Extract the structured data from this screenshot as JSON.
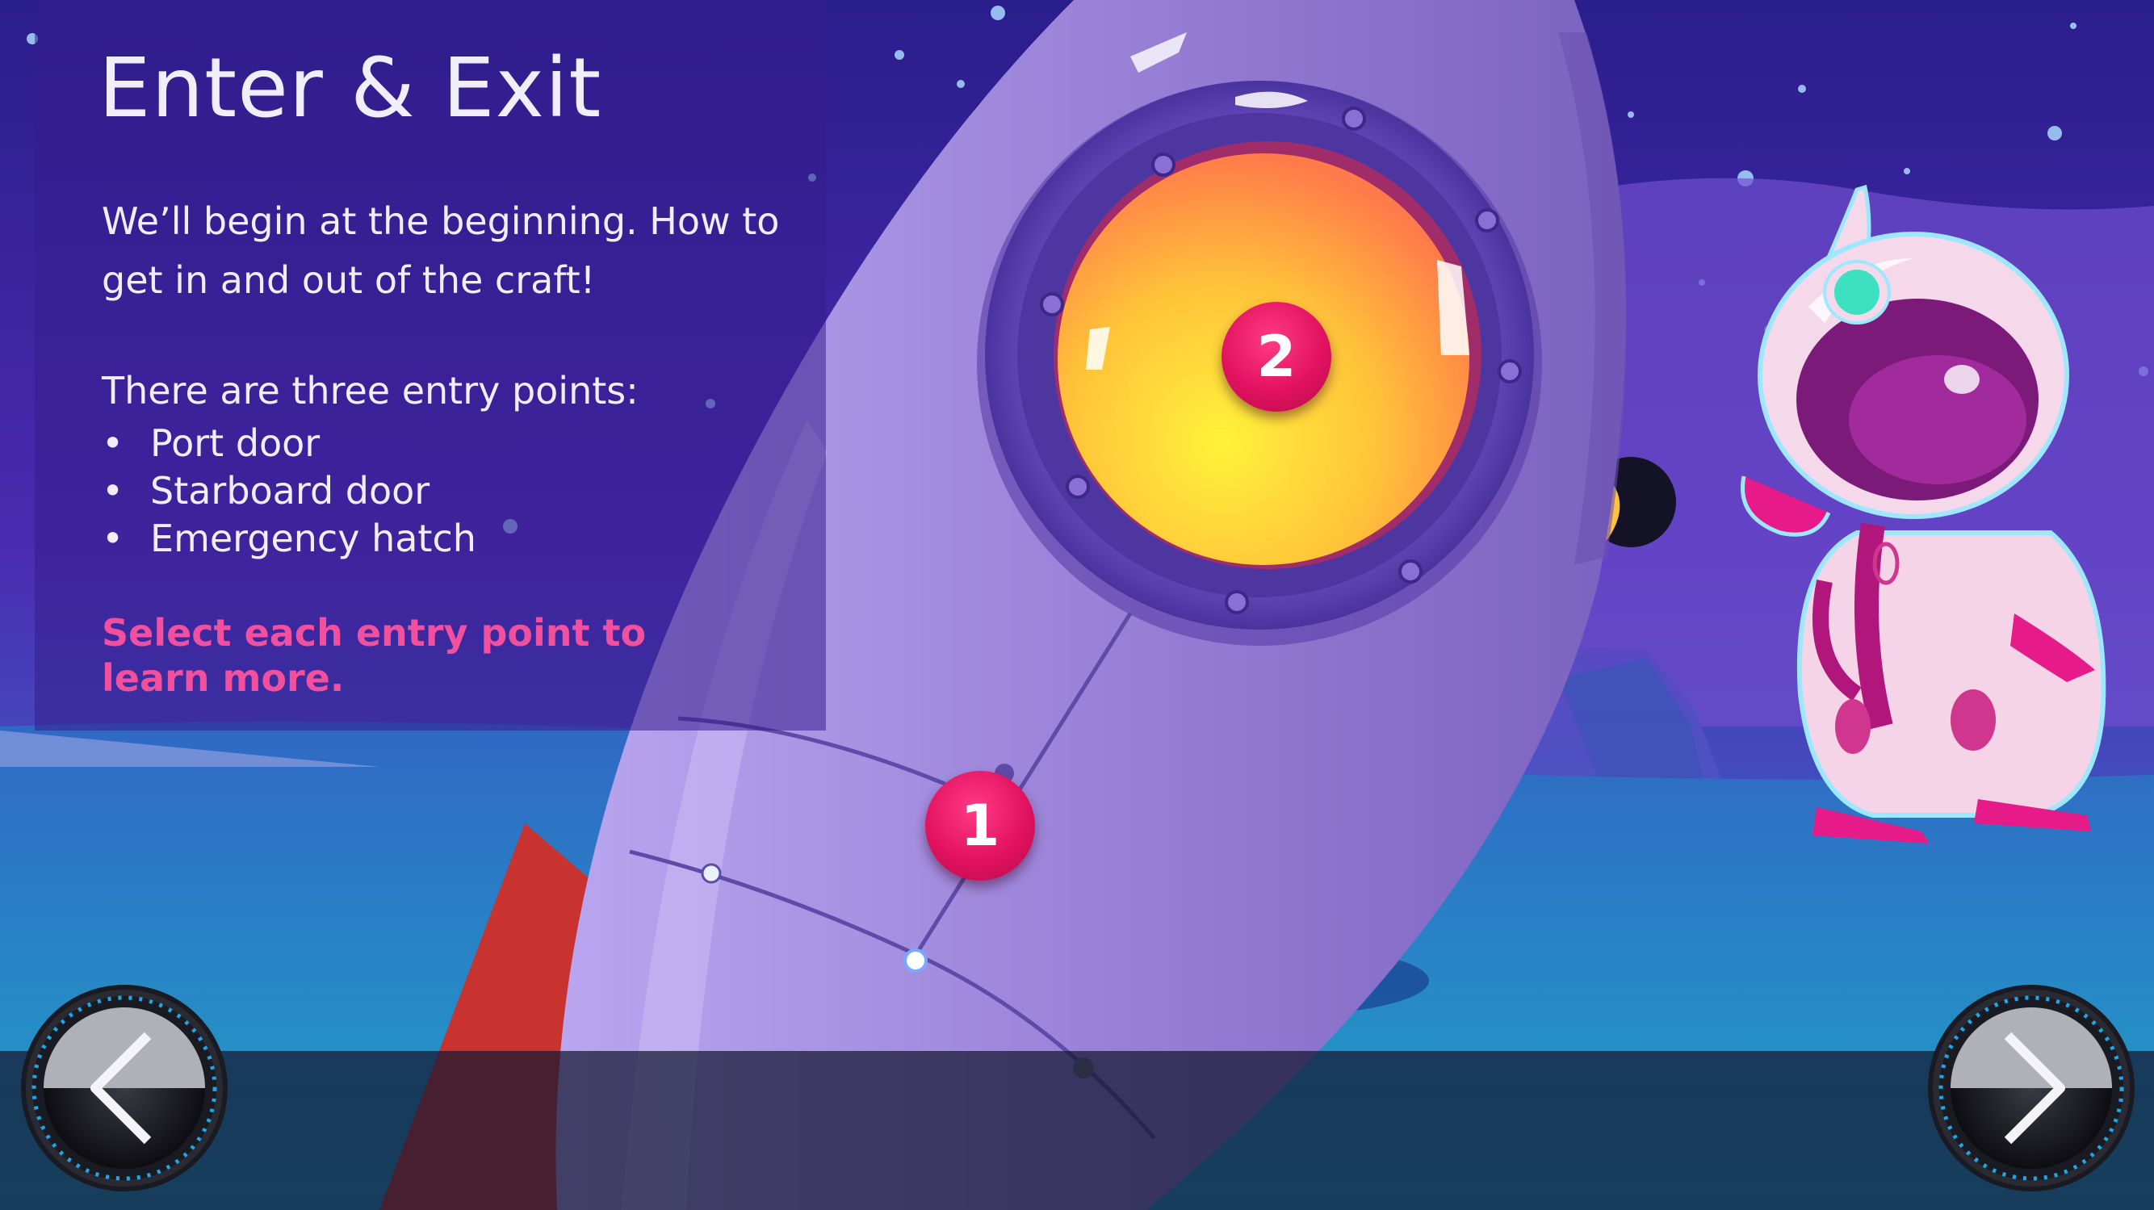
{
  "slide": {
    "title": "Enter & Exit",
    "intro": "We’ll begin at the beginning. How to get in and out of the craft!",
    "entry_heading": "There are three entry points:",
    "bullet_glyph": "•",
    "entry_points": [
      "Port door",
      "Starboard door",
      "Emergency hatch"
    ],
    "call_to_action": "Select each entry point to learn more."
  },
  "hotspots": [
    {
      "label": "1"
    },
    {
      "label": "2"
    }
  ],
  "navigation": {
    "prev_icon": "chevron-left-icon",
    "next_icon": "chevron-right-icon"
  },
  "colors": {
    "sky_top": "#2a1d8c",
    "sky_bottom": "#2a7fc0",
    "accent_pink": "#f0509e",
    "hotspot_red": "#e2125f",
    "rocket_purple": "#9b84d6",
    "porthole_yellow": "#ffd23a"
  }
}
